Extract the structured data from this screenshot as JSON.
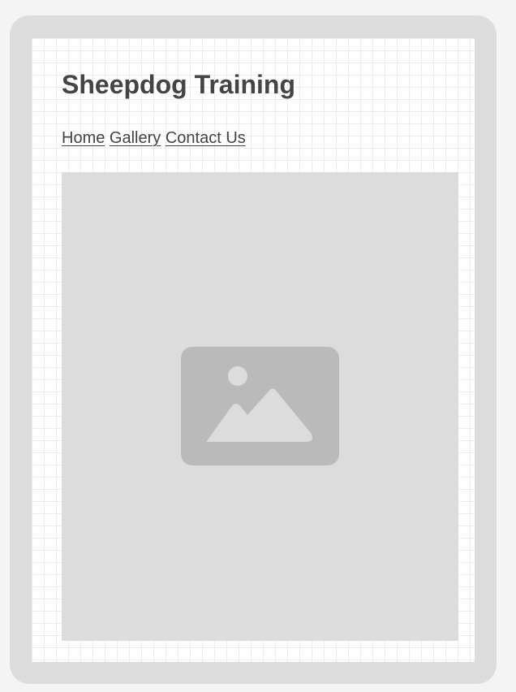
{
  "site": {
    "title": "Sheepdog Training"
  },
  "nav": {
    "items": [
      {
        "label": "Home"
      },
      {
        "label": "Gallery"
      },
      {
        "label": "Contact Us"
      }
    ]
  },
  "hero": {
    "icon": "image-placeholder-icon"
  },
  "colors": {
    "outer_background": "#f4f4f4",
    "frame": "#dcdcdc",
    "screen": "#ffffff",
    "grid_line": "#ececec",
    "text": "#444444",
    "placeholder_fill": "#dcdcdc",
    "icon_fill": "#bababa"
  }
}
